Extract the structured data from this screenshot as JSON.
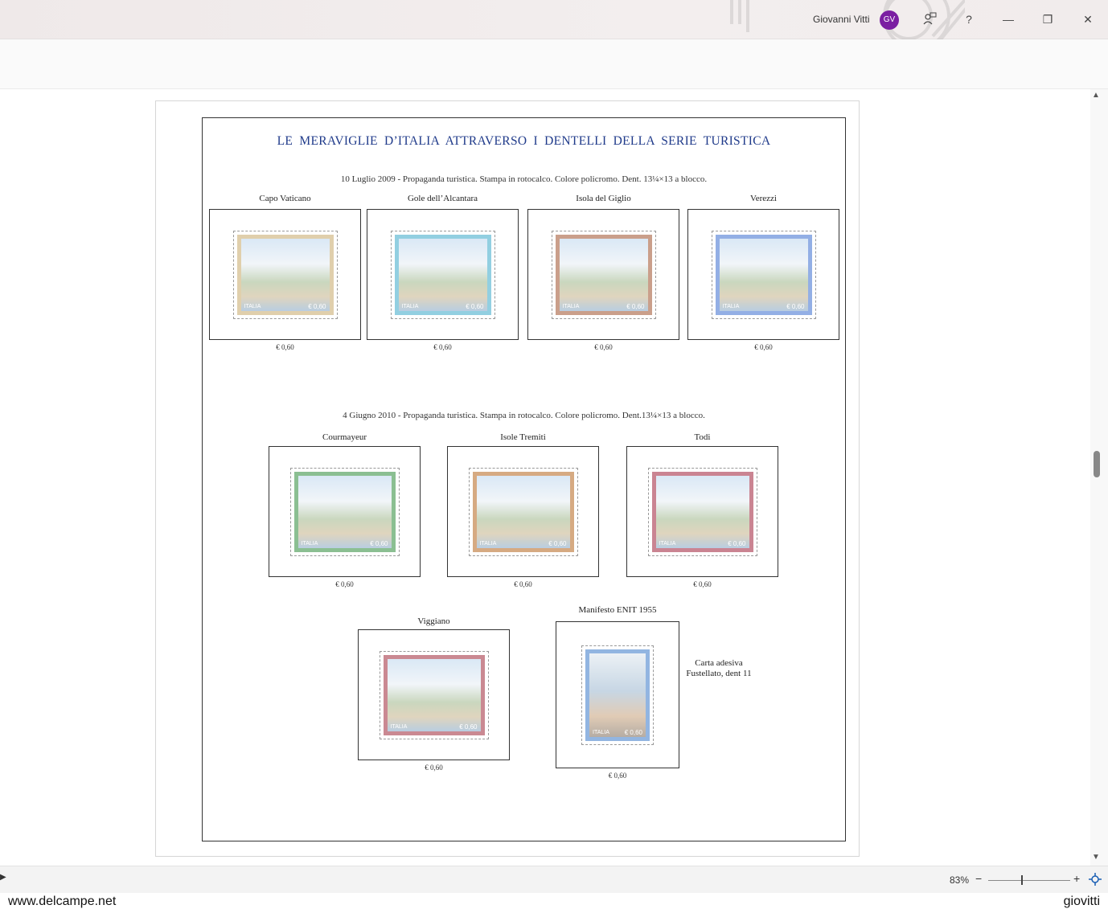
{
  "titlebar": {
    "user_name": "Giovanni Vitti",
    "avatar_initials": "GV",
    "help_label": "?",
    "minimize_label": "—",
    "restore_label": "❐",
    "close_label": "✕",
    "comment_icon": "comment-person-icon"
  },
  "document": {
    "title": "LE MERAVIGLIE D’ITALIA ATTRAVERSO I DENTELLI DELLA SERIE TURISTICA",
    "section1_desc": "10 Luglio 2009 - Propaganda turistica. Stampa in rotocalco. Colore policromo. Dent. 13¼×13 a blocco.",
    "section2_desc": "4 Giugno 2010 - Propaganda turistica. Stampa in rotocalco. Colore policromo. Dent.13¼×13 a blocco.",
    "stamps1": [
      {
        "name": "Capo Vaticano",
        "value": "€ 0,60",
        "country": "ITALIA",
        "face": "€ 0,60",
        "frame_color": "#c8a86a"
      },
      {
        "name": "Gole dell’Alcantara",
        "value": "€ 0,60",
        "country": "ITALIA",
        "face": "€ 0,60",
        "frame_color": "#3aa9c9"
      },
      {
        "name": "Isola del Giglio",
        "value": "€ 0,60",
        "country": "ITALIA",
        "face": "€ 0,60",
        "frame_color": "#a0522d"
      },
      {
        "name": "Verezzi",
        "value": "€ 0,60",
        "country": "ITALIA",
        "face": "€ 0,60",
        "frame_color": "#3b6fd0"
      }
    ],
    "stamps2": [
      {
        "name": "Courmayeur",
        "value": "€ 0,60",
        "country": "ITALIA",
        "face": "€ 0,60",
        "frame_color": "#2e8b3a"
      },
      {
        "name": "Isole Tremiti",
        "value": "€ 0,60",
        "country": "ITALIA",
        "face": "€ 0,60",
        "frame_color": "#b5651d"
      },
      {
        "name": "Todi",
        "value": "€ 0,60",
        "country": "ITALIA",
        "face": "€ 0,60",
        "frame_color": "#a0203a"
      }
    ],
    "stamps3": [
      {
        "name": "Viggiano",
        "value": "€ 0,60",
        "country": "ITALIA",
        "face": "€ 0,60",
        "frame_color": "#a02a3a"
      },
      {
        "name": "Manifesto ENIT 1955",
        "value": "€ 0,60",
        "country": "ITALIA",
        "face": "€ 0,60",
        "frame_color": "#3a7ac9"
      }
    ],
    "note_line1": "Carta adesiva",
    "note_line2": "Fustellato, dent 11"
  },
  "statusbar": {
    "zoom": "83%",
    "zoom_minus": "−",
    "zoom_plus": "+",
    "zoom_fraction": 0.4
  },
  "watermark": {
    "left": "www.delcampe.net",
    "right": "giovitti"
  }
}
